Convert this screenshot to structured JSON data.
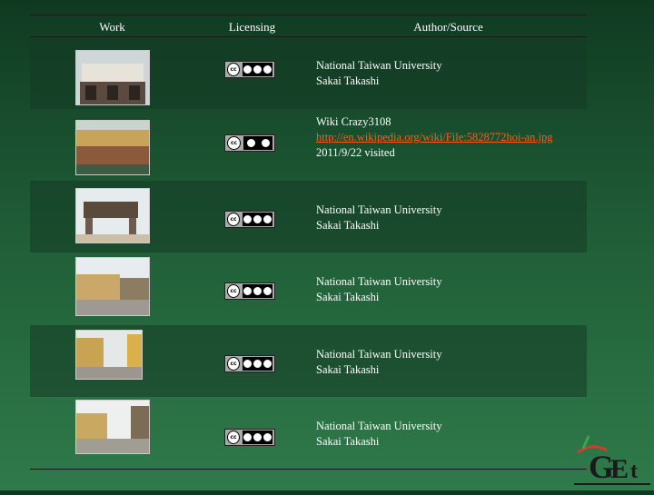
{
  "table": {
    "headers": {
      "work": "Work",
      "licensing": "Licensing",
      "author": "Author/Source"
    },
    "rows": [
      {
        "lines": [
          "National Taiwan University",
          "Sakai Takashi"
        ],
        "license": "cc-by-nc-sa-icon"
      },
      {
        "lines": [
          "Wiki Crazy3108"
        ],
        "link": "http://en.wikipedia.org/wiki/File:5828772hoi-an.jpg",
        "visited": "2011/9/22 visited",
        "license": "cc-by-sa-icon"
      },
      {
        "lines": [
          "National Taiwan University",
          "Sakai Takashi"
        ],
        "license": "cc-by-nc-sa-icon"
      },
      {
        "lines": [
          "National Taiwan University",
          "Sakai Takashi"
        ],
        "license": "cc-by-nc-sa-icon"
      },
      {
        "lines": [
          "National Taiwan University",
          "Sakai Takashi"
        ],
        "license": "cc-by-nc-sa-icon"
      },
      {
        "lines": [
          "National Taiwan University",
          "Sakai Takashi"
        ],
        "license": "cc-by-nc-sa-icon"
      }
    ]
  },
  "colors": {
    "link": "#ff5a1a",
    "background": "#1f5c36"
  },
  "logo": {
    "name": "get-logo"
  }
}
